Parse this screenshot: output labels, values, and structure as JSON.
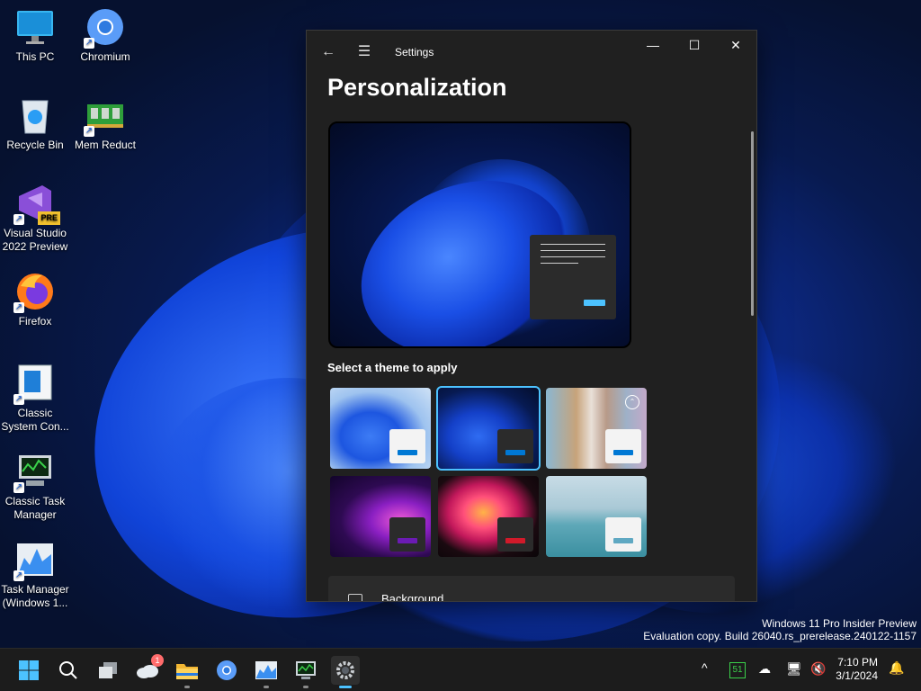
{
  "desktop": {
    "icons": [
      {
        "label": "This PC"
      },
      {
        "label": "Chromium"
      },
      {
        "label": "Recycle Bin"
      },
      {
        "label": "Mem Reduct"
      },
      {
        "label": "Visual Studio 2022 Preview",
        "badge": "PRE"
      },
      {
        "label": "Firefox"
      },
      {
        "label": "Classic System Con..."
      },
      {
        "label": "Classic Task Manager"
      },
      {
        "label": "Task Manager (Windows 1..."
      }
    ],
    "watermark": {
      "line1": "Windows 11 Pro Insider Preview",
      "line2": "Evaluation copy. Build 26040.rs_prerelease.240122-1157"
    }
  },
  "window": {
    "title": "Settings",
    "back_icon": "←",
    "menu_icon": "☰",
    "minimize_icon": "—",
    "maximize_icon": "☐",
    "close_icon": "✕",
    "page_title": "Personalization",
    "section_label": "Select a theme to apply",
    "themes": [
      {
        "name": "windows-light",
        "accent": "#0078d4",
        "selected": false
      },
      {
        "name": "windows-dark",
        "accent": "#0078d4",
        "selected": true
      },
      {
        "name": "windows-spotlight",
        "accent": "#0078d4",
        "selected": false
      },
      {
        "name": "glow",
        "accent": "#6b1bb3",
        "selected": false
      },
      {
        "name": "captured-motion",
        "accent": "#d11a2a",
        "selected": false
      },
      {
        "name": "flow",
        "accent": "#5fa8c2",
        "selected": false
      }
    ],
    "background_row": {
      "label": "Background"
    }
  },
  "taskbar": {
    "apps": [
      "start",
      "search",
      "task-view",
      "onedrive",
      "file-explorer",
      "chromium",
      "task-manager",
      "classic-task-manager",
      "settings"
    ],
    "onedrive_badge": "1",
    "tray": {
      "chevron": "^",
      "counter": "51"
    },
    "clock": {
      "time": "7:10 PM",
      "date": "3/1/2024"
    }
  },
  "colors": {
    "accent": "#4cc2ff",
    "window_bg": "#202020",
    "taskbar_bg": "#1c1c1c"
  }
}
